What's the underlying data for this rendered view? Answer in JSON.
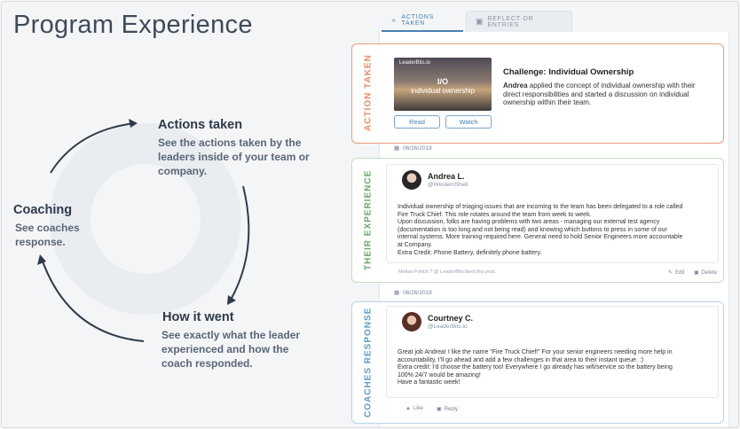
{
  "page": {
    "title": "Program Experience"
  },
  "diagram": {
    "actions": {
      "title": "Actions taken",
      "desc": [
        "See the actions taken by the",
        "leaders inside of your team or",
        "company."
      ]
    },
    "coaching": {
      "title": "Coaching",
      "desc": [
        "See coaches",
        "response."
      ]
    },
    "how": {
      "title": "How it went",
      "desc": [
        "See exactly what the leader",
        "experienced and how the",
        "coach responded."
      ]
    }
  },
  "tabs": [
    {
      "label": "Actions Taken",
      "icon": "lightbulb-icon",
      "active": true
    },
    {
      "label": "Reflect Or Entries",
      "icon": "chat-icon",
      "active": false
    }
  ],
  "action_card": {
    "label": "Action Taken",
    "thumbnail": {
      "brand": "LeaderBits.io",
      "big": "I/O",
      "sub": "individual ownership"
    },
    "read_label": "Read",
    "watch_label": "Watch",
    "challenge_title": "Challenge: Individual Ownership",
    "user": "Andrea",
    "text": "applied the concept of individual ownership with their direct responsibilities and started a discussion on individual ownership within their team."
  },
  "experience_card": {
    "label": "Their Experience",
    "date": "06/26/2019",
    "name": "Andrea L.",
    "handle": "@WesternShell",
    "lines": [
      "Individual ownership of triaging issues that are incoming to the team has been delegated to a role called",
      "Fire Truck Chief. This role rotates around the team from week to week.",
      "Upon discussion, folks are having problems with two areas - managing our external test agency",
      "(documentation is too long and not being read) and knowing which buttons to press in some of our",
      "internal systems. More training required here. General need to hold Senior Engineers more accountable",
      "at Company.",
      "Extra Credit: Phone Battery, definitely phone battery."
    ],
    "meta": "Melisa Politch ? @ LeaderBits liked this post.",
    "edit_label": "Edit",
    "delete_label": "Delete"
  },
  "coach_card": {
    "label": "Coaches Response",
    "date": "06/26/2019",
    "name": "Courtney C.",
    "handle": "@LeaderBits.io",
    "lines": [
      "Great job Andrea! I like the name \"Fire Truck Chief!\" For your senior engineers needing more help in",
      "accountability, I'll go ahead and add a few challenges in that area to their instant queue. :)",
      "Extra credit: I'd choose the battery too! Everywhere I go already has wifi/service so the battery being",
      "100% 24/7 would be amazing!",
      "Have a fantastic week!"
    ],
    "like_label": "Like",
    "reply_label": "Reply"
  },
  "colors": {
    "action": "#e98a62",
    "experience": "#6aa76a",
    "coach": "#5a9cc8",
    "accent": "#4a7fb0"
  }
}
